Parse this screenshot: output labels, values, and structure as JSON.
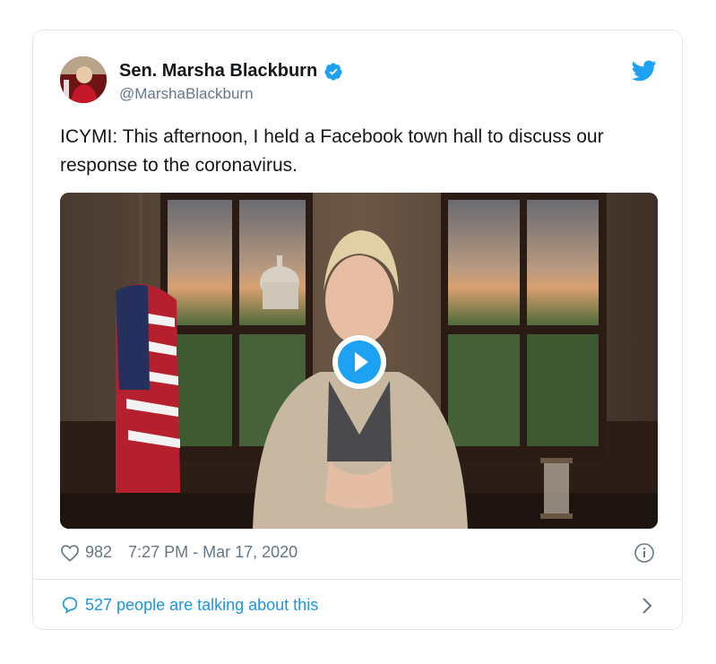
{
  "tweet": {
    "author_name": "Sen. Marsha Blackburn",
    "handle": "@MarshaBlackburn",
    "text": "ICYMI: This afternoon, I held a Facebook town hall to discuss our response to the coronavirus.",
    "likes": "982",
    "timestamp": "7:27 PM - Mar 17, 2020",
    "talking": "527 people are talking about this"
  },
  "icons": {
    "verified": "verified-badge-icon",
    "brand": "twitter-bird-icon",
    "like": "heart-icon",
    "info": "info-icon",
    "reply": "speech-bubble-icon",
    "more": "chevron-right-icon",
    "play": "play-icon"
  },
  "colors": {
    "brand_blue": "#1da1f2",
    "link_blue": "#1b95e0",
    "muted": "#657786",
    "border": "#e1e8ed"
  }
}
